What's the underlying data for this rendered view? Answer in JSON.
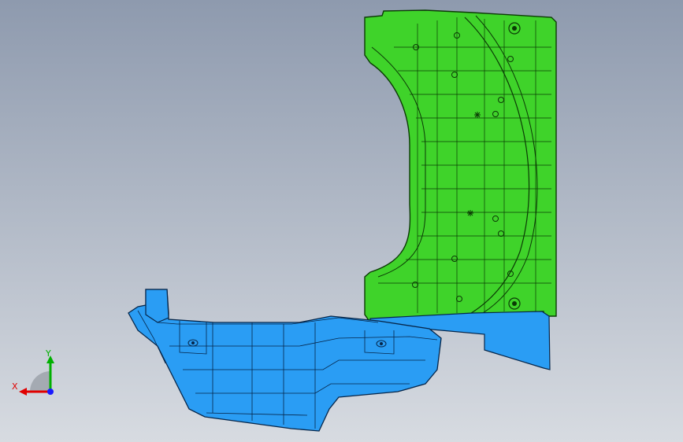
{
  "viewport": {
    "background_top": "#8e9aae",
    "background_bottom": "#d7dbe1"
  },
  "parts": {
    "upper_panel": {
      "color": "#3fd32a",
      "edge_color": "#0b3a05",
      "shape": "curved-wheelhouse-panel"
    },
    "lower_floor": {
      "color": "#2a9df4",
      "edge_color": "#06264a",
      "shape": "floor-tray"
    }
  },
  "triad": {
    "x_label": "X",
    "y_label": "Y",
    "x_color": "#e00000",
    "y_color": "#00b000",
    "z_color": "#1a1aff"
  }
}
